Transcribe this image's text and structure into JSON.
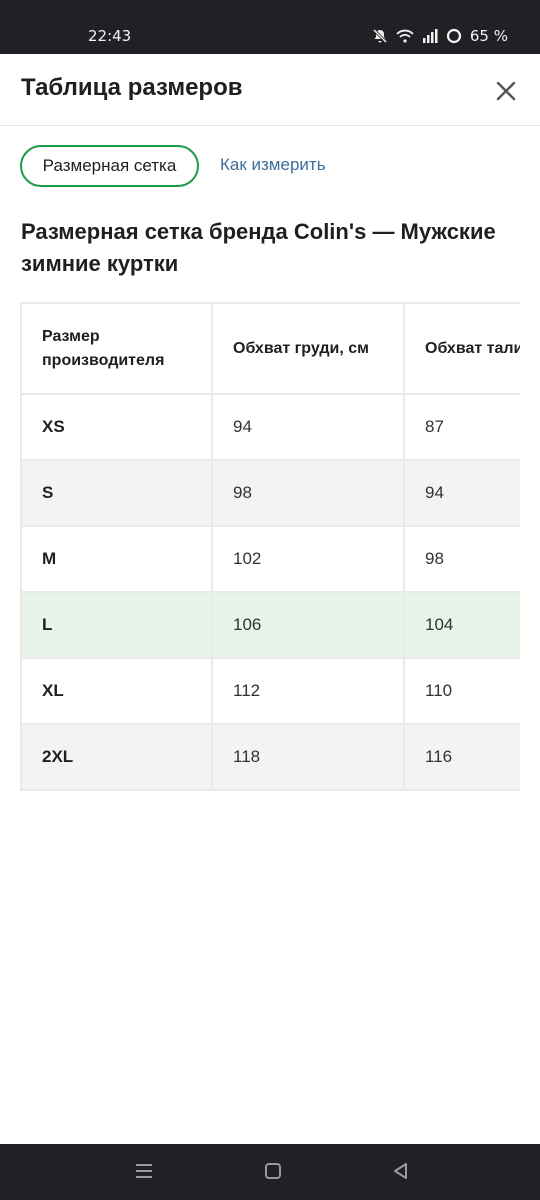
{
  "status_bar": {
    "time": "22:43",
    "battery": "65 %",
    "icons": [
      "mute-icon",
      "wifi-icon",
      "signal-icon",
      "battery-ring-icon"
    ]
  },
  "header": {
    "title": "Таблица размеров",
    "close_icon": "close-icon"
  },
  "tabs": [
    {
      "label": "Размерная сетка",
      "active": true
    },
    {
      "label": "Как измерить",
      "active": false
    }
  ],
  "heading": "Размерная сетка бренда Colin's — Мужские зимние куртки",
  "table": {
    "columns": [
      "Размер производителя",
      "Обхват груди, см",
      "Обхват тали"
    ],
    "rows": [
      {
        "size": "XS",
        "chest": "94",
        "waist": "87"
      },
      {
        "size": "S",
        "chest": "98",
        "waist": "94"
      },
      {
        "size": "M",
        "chest": "102",
        "waist": "98"
      },
      {
        "size": "L",
        "chest": "106",
        "waist": "104"
      },
      {
        "size": "XL",
        "chest": "112",
        "waist": "110"
      },
      {
        "size": "2XL",
        "chest": "118",
        "waist": "116"
      }
    ]
  },
  "colors": {
    "accent_green": "#1d9a45",
    "link_blue": "#3d6e9a",
    "highlight_row": "#e6f4e9",
    "alt_row": "#f3f3f3",
    "system_bar": "#202124"
  },
  "nav_bar": {
    "icons": [
      "recent-apps-icon",
      "home-icon",
      "back-icon"
    ]
  }
}
